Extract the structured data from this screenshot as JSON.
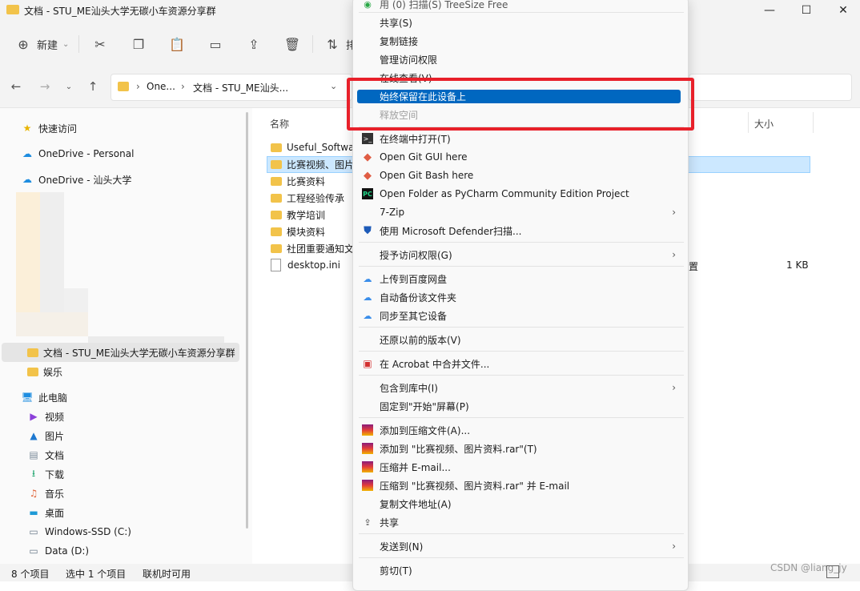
{
  "window": {
    "title": "文档 - STU_ME汕头大学无碳小车资源分享群",
    "controls": [
      "—",
      "☐",
      "✕"
    ]
  },
  "toolbar": {
    "new_label": "新建",
    "truncated_label": "排"
  },
  "address": {
    "crumbs": [
      "One...",
      "文档 - STU_ME汕头..."
    ]
  },
  "nav": {
    "quick_access": "快速访问",
    "onedrive_personal": "OneDrive - Personal",
    "onedrive_stu": "OneDrive - 汕头大学",
    "docs_folder": "文档 - STU_ME汕头大学无碳小车资源分享群",
    "ent_folder": "娱乐",
    "this_pc": "此电脑",
    "videos": "视频",
    "pictures": "图片",
    "documents": "文档",
    "downloads": "下载",
    "music": "音乐",
    "desktop": "桌面",
    "drive_c": "Windows-SSD (C:)",
    "drive_d": "Data (D:)"
  },
  "content": {
    "col_name": "名称",
    "col_size": "大小",
    "files": [
      {
        "name": "Useful_Softwa"
      },
      {
        "name": "比赛视频、图片"
      },
      {
        "name": "比赛资料"
      },
      {
        "name": "工程经验传承"
      },
      {
        "name": "教学培训"
      },
      {
        "name": "模块资料"
      },
      {
        "name": "社团重要通知文"
      },
      {
        "name": "desktop.ini"
      }
    ],
    "desktop_ini_type_partial": "置",
    "desktop_ini_size": "1 KB"
  },
  "status": {
    "count": "8 个项目",
    "selected": "选中 1 个项目",
    "availability": "联机时可用"
  },
  "watermark": "CSDN @liang_jy",
  "menu": {
    "top_partial": "用 (0) 扫描(S) TreeSize Free",
    "share": "共享(S)",
    "copy_link": "复制链接",
    "manage_access": "管理访问权限",
    "view_online": "在线查看(V)",
    "keep_on_device": "始终保留在此设备上",
    "free_space": "释放空间",
    "open_terminal": "在终端中打开(T)",
    "git_gui": "Open Git GUI here",
    "git_bash": "Open Git Bash here",
    "pycharm": "Open Folder as PyCharm Community Edition Project",
    "zip7": "7-Zip",
    "defender": "使用 Microsoft Defender扫描...",
    "give_access": "授予访问权限(G)",
    "baidu_upload": "上传到百度网盘",
    "baidu_backup": "自动备份该文件夹",
    "baidu_sync": "同步至其它设备",
    "restore": "还原以前的版本(V)",
    "acrobat": "在 Acrobat 中合并文件...",
    "include_library": "包含到库中(I)",
    "pin_start": "固定到\"开始\"屏幕(P)",
    "rar_add": "添加到压缩文件(A)...",
    "rar_add_named": "添加到 \"比赛视频、图片资料.rar\"(T)",
    "rar_email": "压缩并 E-mail...",
    "rar_email_named": "压缩到 \"比赛视频、图片资料.rar\" 并 E-mail",
    "copy_path": "复制文件地址(A)",
    "share2": "共享",
    "send_to": "发送到(N)",
    "cut": "剪切(T)"
  }
}
